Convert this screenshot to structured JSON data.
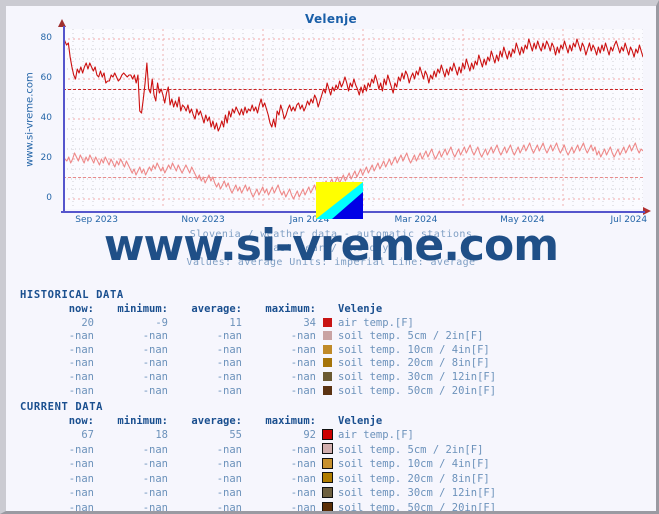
{
  "page": {
    "vertical_site_text": "www.si-vreme.com",
    "watermark": "www.si-vreme.com",
    "bg": "#f6f6fd",
    "accent": "#1a5fa8"
  },
  "chart": {
    "title": "Velenje",
    "caption_lines": [
      "Slovenia / weather data - automatic stations",
      "last year / one day.",
      "Values: average  Units: imperial  Line: average"
    ],
    "flag_icon": {
      "name": "si-vreme-flag-icon",
      "colors": [
        "#ffff00",
        "#00ffff",
        "#0000e6"
      ]
    }
  },
  "chart_data": {
    "type": "line",
    "title": "Velenje",
    "xlabel": "",
    "ylabel": "",
    "ylim": [
      -5,
      85
    ],
    "yticks": [
      0,
      20,
      40,
      60,
      80
    ],
    "xticks": [
      "Sep 2023",
      "Nov 2023",
      "Jan 2024",
      "Mar 2024",
      "May 2024",
      "Jul 2024"
    ],
    "xtick_positions_pct": [
      13.5,
      34.0,
      54.5,
      74.5,
      94.5,
      114.5
    ],
    "grid": true,
    "legend": "none",
    "units": "imperial",
    "line_mode": "average",
    "series": [
      {
        "name": "air temp. [F] - current data",
        "color": "#cc1111",
        "average_line": 55,
        "values": [
          82,
          79,
          77,
          78,
          71,
          66,
          62,
          60,
          65,
          63,
          66,
          63,
          66,
          68,
          65,
          68,
          66,
          64,
          66,
          62,
          61,
          64,
          61,
          63,
          58,
          59,
          59,
          62,
          61,
          63,
          61,
          59,
          60,
          62,
          63,
          62,
          61,
          62,
          62,
          60,
          62,
          58,
          62,
          44,
          43,
          50,
          58,
          68,
          55,
          53,
          60,
          52,
          49,
          58,
          53,
          55,
          52,
          48,
          53,
          56,
          47,
          50,
          46,
          49,
          46,
          51,
          44,
          47,
          46,
          44,
          47,
          43,
          45,
          42,
          40,
          45,
          42,
          44,
          41,
          38,
          42,
          39,
          41,
          36,
          39,
          35,
          38,
          34,
          36,
          39,
          36,
          42,
          38,
          44,
          41,
          45,
          43,
          46,
          44,
          42,
          45,
          42,
          46,
          43,
          45,
          44,
          47,
          44,
          46,
          43,
          47,
          50,
          46,
          48,
          45,
          42,
          38,
          36,
          40,
          36,
          44,
          42,
          47,
          44,
          40,
          42,
          45,
          47,
          44,
          46,
          44,
          47,
          48,
          45,
          47,
          44,
          46,
          49,
          47,
          50,
          48,
          52,
          50,
          46,
          49,
          52,
          55,
          53,
          58,
          55,
          52,
          56,
          54,
          57,
          55,
          59,
          56,
          58,
          61,
          58,
          54,
          58,
          56,
          60,
          57,
          55,
          52,
          56,
          53,
          57,
          54,
          58,
          56,
          60,
          58,
          62,
          59,
          55,
          58,
          54,
          60,
          57,
          62,
          59,
          56,
          53,
          58,
          56,
          61,
          59,
          63,
          60,
          64,
          62,
          58,
          61,
          63,
          60,
          64,
          62,
          66,
          63,
          60,
          64,
          62,
          58,
          62,
          60,
          64,
          61,
          65,
          63,
          67,
          64,
          61,
          65,
          62,
          66,
          64,
          68,
          65,
          62,
          66,
          63,
          68,
          65,
          70,
          67,
          64,
          68,
          65,
          69,
          67,
          72,
          69,
          66,
          70,
          67,
          71,
          69,
          74,
          71,
          68,
          72,
          69,
          74,
          71,
          76,
          73,
          70,
          74,
          71,
          75,
          73,
          78,
          75,
          72,
          76,
          73,
          77,
          75,
          80,
          77,
          74,
          78,
          75,
          79,
          76,
          74,
          78,
          75,
          79,
          77,
          74,
          78,
          76,
          72,
          76,
          73,
          77,
          75,
          79,
          76,
          73,
          77,
          74,
          78,
          76,
          80,
          77,
          74,
          78,
          76,
          72,
          75,
          78,
          74,
          77,
          75,
          72,
          76,
          73,
          77,
          74,
          78,
          75,
          72,
          76,
          74,
          77,
          79,
          76,
          73,
          76,
          74,
          78,
          75,
          72,
          76,
          74,
          71,
          75,
          73,
          77,
          74,
          71
        ]
      },
      {
        "name": "air temp. [F] - historical data",
        "color": "#ee8888",
        "average_line": 11,
        "values": [
          22,
          20,
          19,
          21,
          18,
          20,
          23,
          21,
          19,
          22,
          20,
          18,
          21,
          19,
          22,
          20,
          18,
          21,
          19,
          17,
          20,
          18,
          21,
          19,
          17,
          20,
          18,
          16,
          19,
          17,
          20,
          18,
          16,
          19,
          17,
          15,
          13,
          15,
          12,
          14,
          16,
          13,
          15,
          12,
          14,
          16,
          14,
          17,
          15,
          18,
          16,
          14,
          16,
          13,
          15,
          17,
          15,
          18,
          16,
          14,
          17,
          15,
          13,
          15,
          17,
          15,
          13,
          16,
          14,
          12,
          10,
          12,
          9,
          11,
          8,
          10,
          12,
          9,
          11,
          8,
          6,
          8,
          5,
          7,
          9,
          6,
          8,
          5,
          3,
          5,
          7,
          4,
          6,
          3,
          5,
          7,
          4,
          6,
          3,
          1,
          3,
          5,
          2,
          4,
          6,
          3,
          5,
          2,
          4,
          6,
          3,
          5,
          7,
          4,
          2,
          4,
          1,
          3,
          5,
          2,
          0,
          2,
          4,
          1,
          3,
          5,
          2,
          4,
          6,
          3,
          5,
          7,
          4,
          6,
          8,
          5,
          7,
          9,
          6,
          8,
          10,
          7,
          9,
          11,
          8,
          10,
          12,
          9,
          11,
          13,
          10,
          12,
          14,
          11,
          13,
          15,
          12,
          14,
          16,
          13,
          15,
          17,
          14,
          16,
          18,
          15,
          17,
          19,
          16,
          18,
          20,
          17,
          19,
          21,
          18,
          20,
          22,
          19,
          21,
          23,
          20,
          18,
          20,
          22,
          19,
          21,
          23,
          20,
          22,
          24,
          21,
          23,
          25,
          22,
          20,
          22,
          24,
          21,
          23,
          25,
          22,
          24,
          26,
          23,
          21,
          23,
          25,
          22,
          24,
          26,
          23,
          25,
          27,
          24,
          22,
          24,
          26,
          23,
          21,
          23,
          25,
          22,
          24,
          26,
          23,
          25,
          27,
          24,
          22,
          24,
          26,
          23,
          25,
          27,
          24,
          22,
          24,
          26,
          23,
          25,
          27,
          24,
          26,
          28,
          25,
          23,
          25,
          27,
          24,
          26,
          28,
          25,
          23,
          25,
          27,
          24,
          26,
          28,
          25,
          23,
          25,
          27,
          24,
          22,
          24,
          26,
          23,
          25,
          27,
          24,
          26,
          28,
          25,
          23,
          25,
          27,
          24,
          26,
          22,
          24,
          21,
          23,
          25,
          22,
          24,
          26,
          23,
          21,
          23,
          25,
          22,
          24,
          26,
          23,
          25,
          27,
          24,
          26,
          28,
          25,
          23,
          25,
          24
        ]
      }
    ]
  },
  "historical": {
    "block_title": "HISTORICAL DATA",
    "headers": [
      "now:",
      "minimum:",
      "average:",
      "maximum:",
      "Velenje"
    ],
    "rows": [
      {
        "now": "20",
        "minimum": "-9",
        "average": "11",
        "maximum": "34",
        "color": "#c81414",
        "label": "air temp.[F]"
      },
      {
        "now": "-nan",
        "minimum": "-nan",
        "average": "-nan",
        "maximum": "-nan",
        "color": "#c9a3a3",
        "label": "soil temp. 5cm / 2in[F]"
      },
      {
        "now": "-nan",
        "minimum": "-nan",
        "average": "-nan",
        "maximum": "-nan",
        "color": "#c08a28",
        "label": "soil temp. 10cm / 4in[F]"
      },
      {
        "now": "-nan",
        "minimum": "-nan",
        "average": "-nan",
        "maximum": "-nan",
        "color": "#a5740a",
        "label": "soil temp. 20cm / 8in[F]"
      },
      {
        "now": "-nan",
        "minimum": "-nan",
        "average": "-nan",
        "maximum": "-nan",
        "color": "#6b5a32",
        "label": "soil temp. 30cm / 12in[F]"
      },
      {
        "now": "-nan",
        "minimum": "-nan",
        "average": "-nan",
        "maximum": "-nan",
        "color": "#5c3312",
        "label": "soil temp. 50cm / 20in[F]"
      }
    ]
  },
  "current": {
    "block_title": "CURRENT DATA",
    "headers": [
      "now:",
      "minimum:",
      "average:",
      "maximum:",
      "Velenje"
    ],
    "rows": [
      {
        "now": "67",
        "minimum": "18",
        "average": "55",
        "maximum": "92",
        "color": "#cc0000",
        "label": "air temp.[F]"
      },
      {
        "now": "-nan",
        "minimum": "-nan",
        "average": "-nan",
        "maximum": "-nan",
        "color": "#d2aeae",
        "label": "soil temp. 5cm / 2in[F]"
      },
      {
        "now": "-nan",
        "minimum": "-nan",
        "average": "-nan",
        "maximum": "-nan",
        "color": "#c8912e",
        "label": "soil temp. 10cm / 4in[F]"
      },
      {
        "now": "-nan",
        "minimum": "-nan",
        "average": "-nan",
        "maximum": "-nan",
        "color": "#b07c00",
        "label": "soil temp. 20cm / 8in[F]"
      },
      {
        "now": "-nan",
        "minimum": "-nan",
        "average": "-nan",
        "maximum": "-nan",
        "color": "#6e6040",
        "label": "soil temp. 30cm / 12in[F]"
      },
      {
        "now": "-nan",
        "minimum": "-nan",
        "average": "-nan",
        "maximum": "-nan",
        "color": "#5a2e08",
        "label": "soil temp. 50cm / 20in[F]"
      }
    ]
  }
}
